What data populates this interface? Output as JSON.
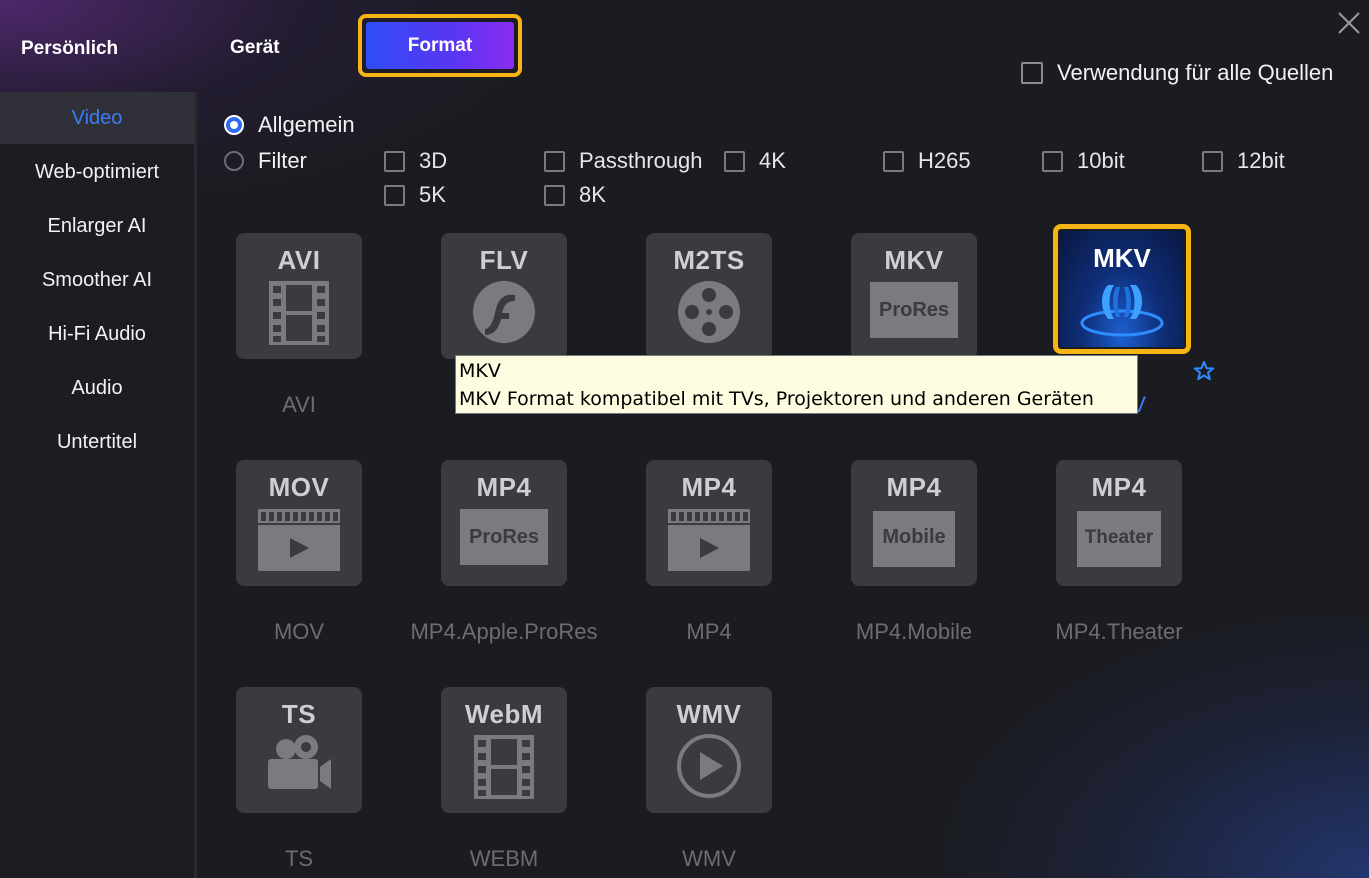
{
  "header": {
    "tabs": [
      "Persönlich",
      "Gerät",
      "Format"
    ],
    "active_tab": "Format",
    "apply_all_label": "Verwendung für alle Quellen"
  },
  "sidebar": {
    "items": [
      {
        "label": "Video",
        "active": true
      },
      {
        "label": "Web-optimiert",
        "active": false
      },
      {
        "label": "Enlarger AI",
        "active": false
      },
      {
        "label": "Smoother AI",
        "active": false
      },
      {
        "label": "Hi-Fi Audio",
        "active": false
      },
      {
        "label": "Audio",
        "active": false
      },
      {
        "label": "Untertitel",
        "active": false
      }
    ]
  },
  "filters": {
    "radio_general": "Allgemein",
    "radio_filter": "Filter",
    "selected": "Allgemein",
    "checkboxes": [
      "3D",
      "Passthrough",
      "4K",
      "H265",
      "10bit",
      "12bit",
      "5K",
      "8K"
    ]
  },
  "formats": [
    {
      "code": "AVI",
      "sub": "",
      "label": "AVI",
      "icon": "film-strip-icon"
    },
    {
      "code": "FLV",
      "sub": "",
      "label": "FLV",
      "icon": "flash-icon"
    },
    {
      "code": "M2TS",
      "sub": "",
      "label": "M2TS",
      "icon": "film-reel-icon"
    },
    {
      "code": "MKV",
      "sub": "ProRes",
      "label": "MKV.ProRes",
      "icon": "prores-icon"
    },
    {
      "code": "MKV",
      "sub": "",
      "label": "MKV",
      "icon": "mkv-logo-icon",
      "selected": true
    },
    {
      "code": "MOV",
      "sub": "",
      "label": "MOV",
      "icon": "clapper-icon"
    },
    {
      "code": "MP4",
      "sub": "ProRes",
      "label": "MP4.Apple.ProRes",
      "icon": "prores-icon"
    },
    {
      "code": "MP4",
      "sub": "",
      "label": "MP4",
      "icon": "clapper-icon"
    },
    {
      "code": "MP4",
      "sub": "Mobile",
      "label": "MP4.Mobile",
      "icon": "mobile-icon"
    },
    {
      "code": "MP4",
      "sub": "Theater",
      "label": "MP4.Theater",
      "icon": "theater-icon"
    },
    {
      "code": "TS",
      "sub": "",
      "label": "TS",
      "icon": "video-camera-icon"
    },
    {
      "code": "WebM",
      "sub": "",
      "label": "WEBM",
      "icon": "film-strip-icon"
    },
    {
      "code": "WMV",
      "sub": "",
      "label": "WMV",
      "icon": "play-circle-icon"
    }
  ],
  "tooltip": {
    "title": "MKV",
    "description": "MKV Format kompatibel mit TVs, Projektoren und anderen Geräten"
  },
  "colors": {
    "accent_blue": "#3a7cf5",
    "highlight_yellow": "#f7b515",
    "tile_bg": "#3a3b3f"
  }
}
